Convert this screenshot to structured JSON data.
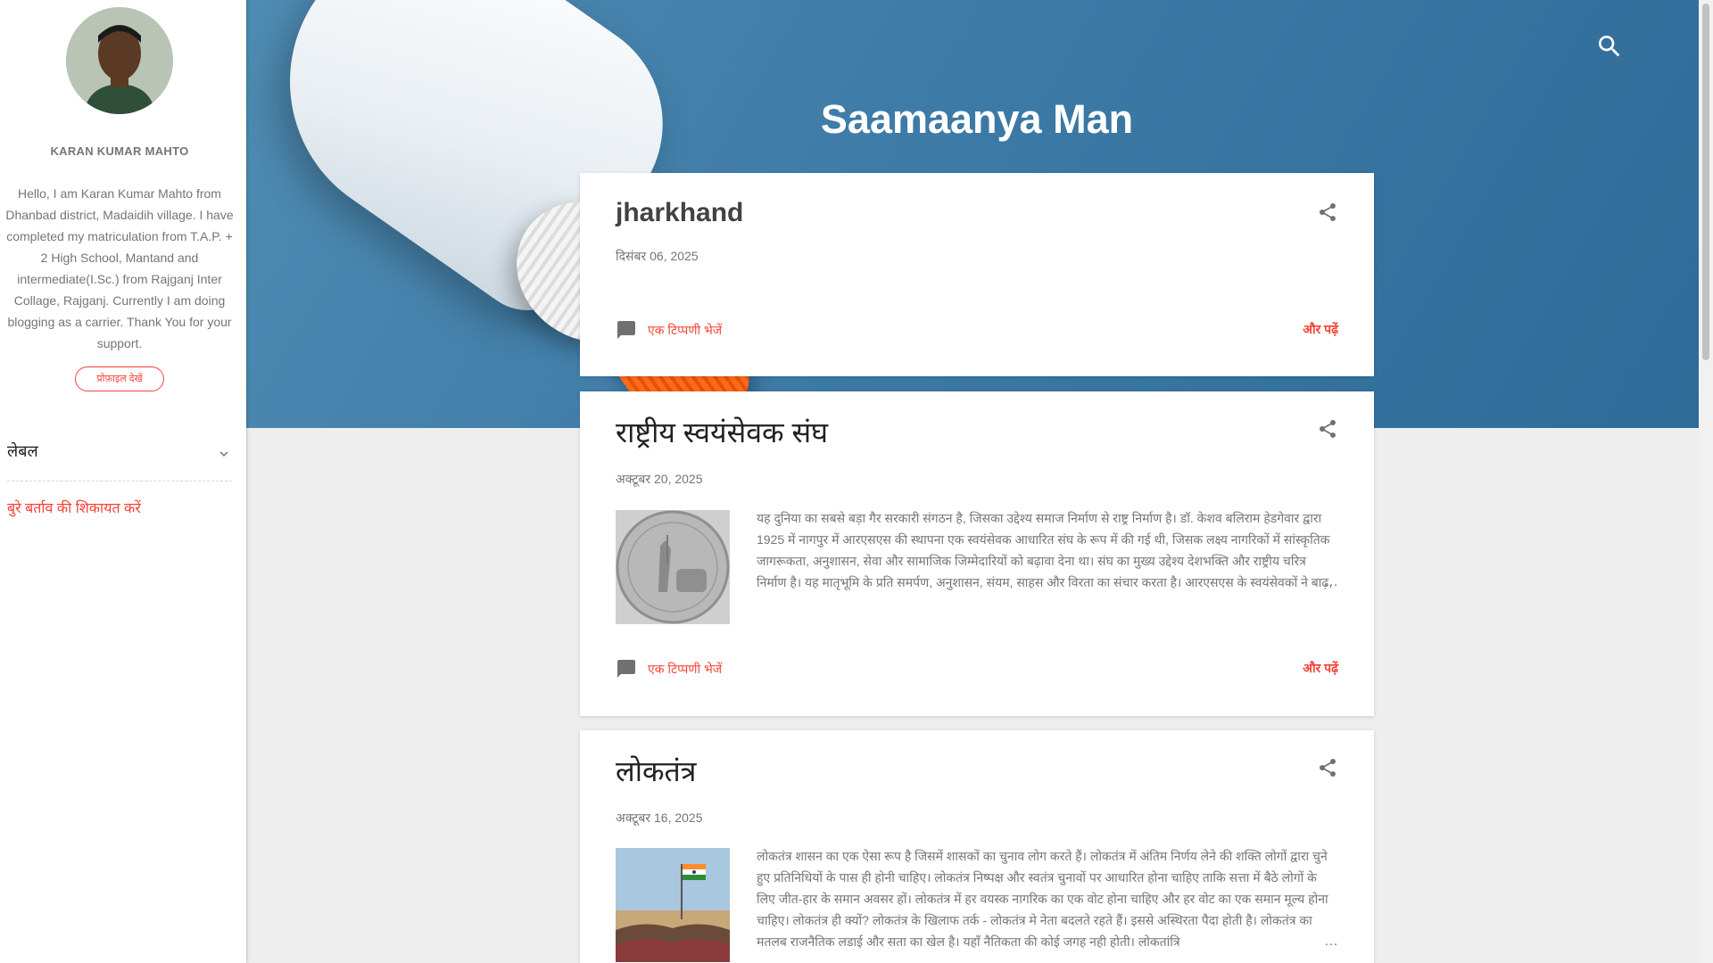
{
  "header": {
    "blog_title": "Saamaanya Man",
    "search_icon": "search-icon"
  },
  "sidebar": {
    "profile_name": "KARAN KUMAR MAHTO",
    "profile_about": "Hello, I am Karan Kumar Mahto from Dhanbad district, Madaidih village. I have completed my matriculation from T.A.P. + 2 High School, Mantand and intermediate(I.Sc.) from Rajganj Inter Collage, Rajganj. Currently I am doing blogging as a carrier. Thank You for your support.",
    "profile_button": "प्रोफ़ाइल देखें",
    "labels_heading": "लेबल",
    "report_link": "बुरे बर्ताव की शिकायत करें"
  },
  "posts": [
    {
      "title": "jharkhand",
      "date": "दिसंबर 06, 2025",
      "comment_label": "एक टिप्पणी भेजें",
      "read_more": "और पढ़ें"
    },
    {
      "title": "राष्ट्रीय स्वयंसेवक संघ",
      "date": "अक्टूबर 20, 2025",
      "snippet": " यह दुनिया का सबसे बड़ा गैर सरकारी संगठन है, जिसका उद्देश्य समाज निर्माण से राष्ट्र निर्माण है। डॉ. केशव बलिराम हेडगेवार द्वारा 1925 में नागपुर में आरएसएस की स्थापना एक स्वयंसेवक आधारित संघ के रूप में की गई थी, जिसक लक्ष्य नागरिकों में सांस्कृतिक जागरूकता, अनुशासन, सेवा और सामाजिक जिम्मेदारियों को बढ़ावा देना था। संघ का मुख्य उद्देश्य देशभक्ति और राष्ट्रीय चरित्र निर्माण है। यह मातृभूमि के प्रति समर्पण, अनुशासन, संयम, साहस और विरता का संचार करता है। आरएसएस के स्वयंसेवकों ने बाढ़, भूकंप और चक्रवात जैसी प्राकृतिक आपदाओं के दौरान राहत और पुनर्वास कार्यों में स",
      "ellipsis": "…",
      "comment_label": "एक टिप्पणी भेजें",
      "read_more": "और पढ़ें"
    },
    {
      "title": "लोकतंत्र",
      "date": "अक्टूबर 16, 2025",
      "snippet": "लोकतंत्र शासन का एक ऐसा रूप है जिसमें शासकों का चुनाव लोग करते हैं। लोकतंत्र में अंतिम निर्णय लेने की शक्ति लोगों द्वारा चुने हुए प्रतिनिधियों के पास ही होनी चाहिए। लोकतंत्र निष्पक्ष और स्वतंत्र चुनावों पर आधारित होना चाहिए ताकि सत्ता में बैठे लोगों के लिए जीत-हार के समान अवसर हों। लोकतंत्र में हर वयस्क नागरिक का एक वोट होना चाहिए और हर वोट का एक समान मूल्य होना चाहिए। लोकतंत्र ही क्यों? लोकतंत्र के खिलाफ तर्क - लोकतंत्र मे नेता बदलते रहते हैं। इससे अस्थिरता पैदा होती है। लोकतंत्र का मतलब राजनैतिक लडाई और सता का खेल है। यहाँ नैतिकता की कोई जगह नही होती। लोकतांत्रि",
      "ellipsis": "…"
    }
  ],
  "colors": {
    "accent": "#f44336",
    "banner": "#3d7aa6",
    "background": "#eeeeee"
  }
}
